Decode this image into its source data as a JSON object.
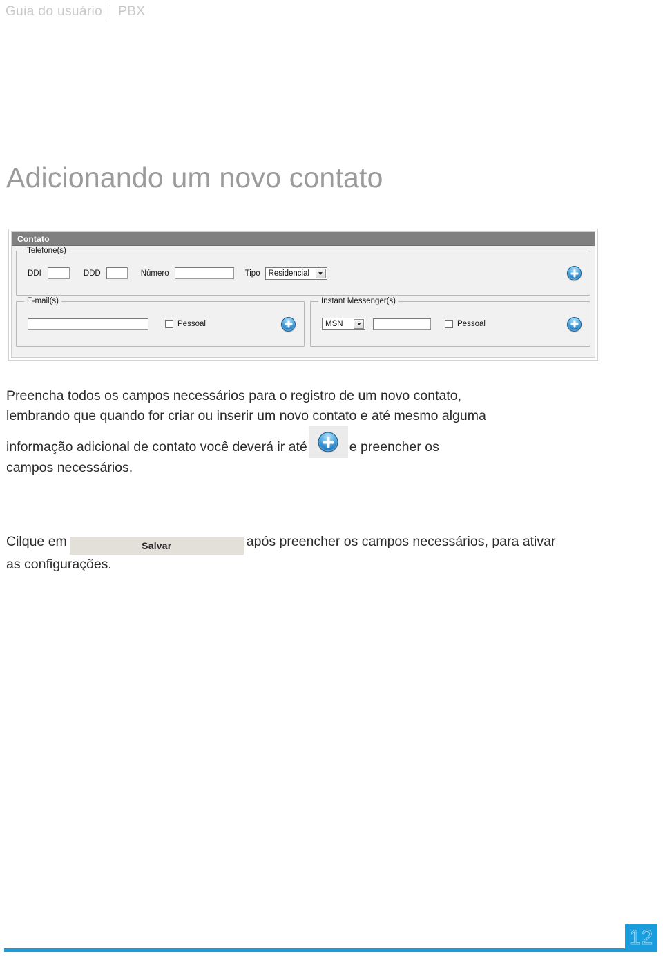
{
  "header": {
    "guide_label": "Guia do usuário",
    "product_label": "PBX"
  },
  "page_title": "Adicionando um novo contato",
  "app_screenshot": {
    "window_title": "Contato",
    "phone_group": {
      "legend": "Telefone(s)",
      "ddi_label": "DDI",
      "ddi_value": "",
      "ddd_label": "DDD",
      "ddd_value": "",
      "numero_label": "Número",
      "numero_value": "",
      "tipo_label": "Tipo",
      "tipo_value": "Residencial",
      "add_icon": "plus-circle-icon"
    },
    "email_group": {
      "legend": "E-mail(s)",
      "email_value": "",
      "personal_label": "Pessoal",
      "add_icon": "plus-circle-icon"
    },
    "im_group": {
      "legend": "Instant Messenger(s)",
      "service_value": "MSN",
      "account_value": "",
      "personal_label": "Pessoal",
      "add_icon": "plus-circle-icon"
    }
  },
  "body": {
    "paragraph_part1": "Preencha todos os campos necessários para o registro de um novo contato, lembrando que quando for criar ou inserir um novo contato e até mesmo alguma informação adicional de contato você deverá ir até",
    "paragraph_part2": "e preencher os campos necessários.",
    "inline_icon": "plus-circle-icon"
  },
  "save_line": {
    "prefix": "Cilque em",
    "button_label": "Salvar",
    "suffix": "após preencher os campos necessários, para ativar as configurações."
  },
  "footer": {
    "page_number": "12",
    "accent_color": "#1a9ddd"
  }
}
